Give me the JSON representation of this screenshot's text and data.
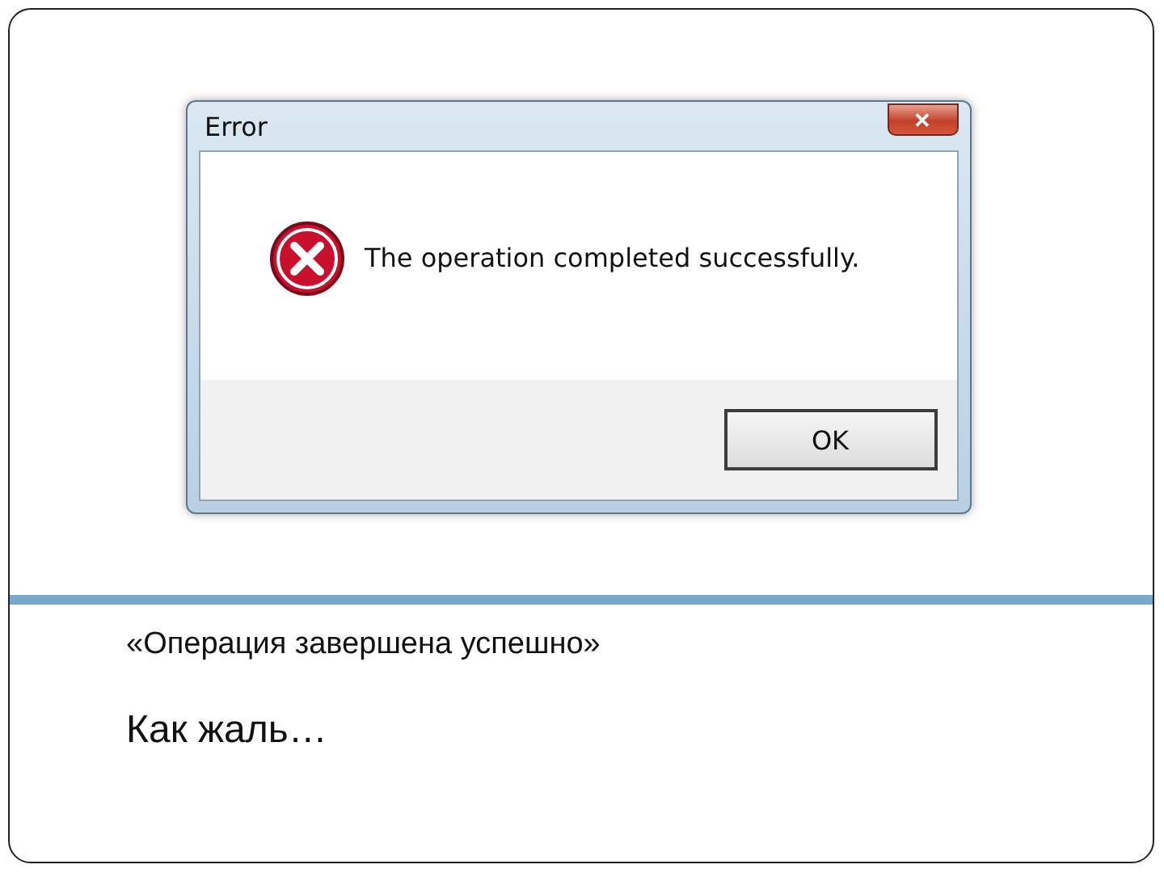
{
  "dialog": {
    "title": "Error",
    "close_glyph": "✕",
    "message": "The operation completed successfully.",
    "buttons": [
      {
        "label": "OK",
        "selected": true
      }
    ]
  },
  "slide": {
    "caption": "«Операция завершена успешно»",
    "comment": "Как жаль…"
  }
}
